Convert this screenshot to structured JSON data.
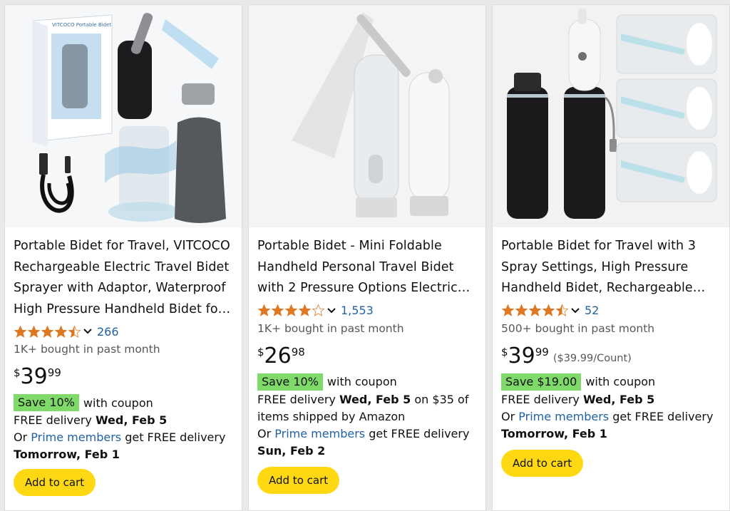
{
  "products": [
    {
      "title": "Portable Bidet for Travel, VITCOCO Rechargeable Electric Travel Bidet Sprayer with Adaptor, Waterproof High Pressure Handheld Bidet fo…",
      "box_label": "VITCOCO Portable Bidet",
      "rating": 4.5,
      "rating_count": "266",
      "bought": "1K+ bought in past month",
      "price_symbol": "$",
      "price_whole": "39",
      "price_fraction": "99",
      "price_unit": "",
      "save_label": "Save 10%",
      "coupon_text": "with coupon",
      "delivery_prefix": "FREE delivery ",
      "delivery_date": "Wed, Feb 5",
      "delivery_suffix": "",
      "prime_prefix": "Or ",
      "prime_link": "Prime members",
      "prime_suffix": " get FREE delivery",
      "fast_date": "Tomorrow, Feb 1",
      "cart_label": "Add to cart"
    },
    {
      "title": "Portable Bidet - Mini Foldable Handheld Personal Travel Bidet with 2 Pressure Options Electric…",
      "rating": 4.0,
      "rating_count": "1,553",
      "bought": "1K+ bought in past month",
      "price_symbol": "$",
      "price_whole": "26",
      "price_fraction": "98",
      "price_unit": "",
      "save_label": "Save 10%",
      "coupon_text": "with coupon",
      "delivery_prefix": "FREE delivery ",
      "delivery_date": "Wed, Feb 5",
      "delivery_suffix": " on $35 of items shipped by Amazon",
      "prime_prefix": "Or ",
      "prime_link": "Prime members",
      "prime_suffix": " get FREE delivery",
      "fast_date": "Sun, Feb 2",
      "cart_label": "Add to cart"
    },
    {
      "title": "Portable Bidet for Travel with 3 Spray Settings, High Pressure Handheld Bidet, Rechargeable…",
      "rating": 4.5,
      "rating_count": "52",
      "bought": "500+ bought in past month",
      "price_symbol": "$",
      "price_whole": "39",
      "price_fraction": "99",
      "price_unit": "($39.99/Count)",
      "save_label": "Save $19.00",
      "coupon_text": "with coupon",
      "delivery_prefix": "FREE delivery ",
      "delivery_date": "Wed, Feb 5",
      "delivery_suffix": "",
      "prime_prefix": "Or ",
      "prime_link": "Prime members",
      "prime_suffix": " get FREE delivery",
      "fast_date": "Tomorrow, Feb 1",
      "cart_label": "Add to cart"
    }
  ],
  "colors": {
    "star": "#de7921",
    "link": "#2162a1",
    "save_badge": "#7fda69",
    "cart_button": "#ffd814"
  },
  "icons": [
    "star-icon",
    "chevron-down-icon"
  ]
}
